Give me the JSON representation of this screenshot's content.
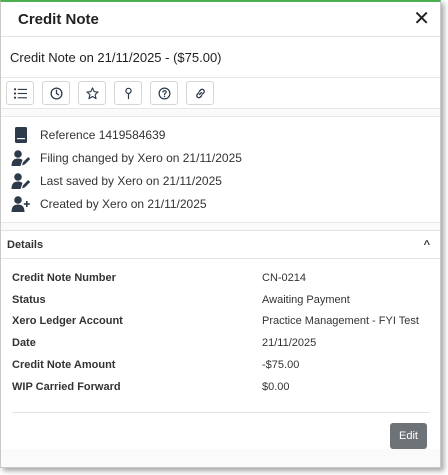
{
  "header": {
    "title": "Credit Note",
    "close_icon": "close-icon"
  },
  "subtitle": "Credit Note on 21/11/2025 - ($75.00)",
  "toolbar": {
    "icons": [
      "list-icon",
      "clock-icon",
      "star-icon",
      "pin-icon",
      "help-icon",
      "link-icon"
    ]
  },
  "activity": [
    {
      "icon": "document-icon",
      "text": "Reference 1419584639"
    },
    {
      "icon": "user-edit-icon",
      "text": "Filing changed by Xero on 21/11/2025"
    },
    {
      "icon": "user-edit-icon",
      "text": "Last saved by Xero on 21/11/2025"
    },
    {
      "icon": "user-add-icon",
      "text": "Created by Xero on 21/11/2025"
    }
  ],
  "details": {
    "title": "Details",
    "rows": [
      {
        "label": "Credit Note Number",
        "value": "CN-0214"
      },
      {
        "label": "Status",
        "value": "Awaiting Payment"
      },
      {
        "label": "Xero Ledger Account",
        "value": "Practice Management - FYI Test"
      },
      {
        "label": "Date",
        "value": "21/11/2025"
      },
      {
        "label": "Credit Note Amount",
        "value": "-$75.00"
      },
      {
        "label": "WIP Carried Forward",
        "value": "$0.00"
      }
    ],
    "edit_label": "Edit"
  },
  "colors": {
    "accent_border": "#4caf50",
    "icon": "#2d3a4a",
    "edit_button": "#6e7377"
  }
}
